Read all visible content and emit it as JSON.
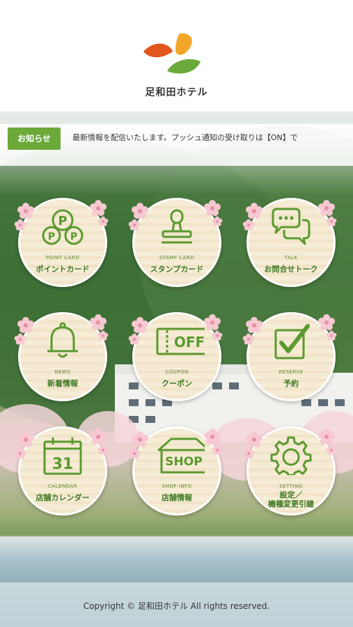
{
  "header": {
    "brand_name": "足和田ホテル",
    "logo_colors": [
      "#e3561c",
      "#f2a628",
      "#6aa93a"
    ]
  },
  "notice": {
    "tag_label": "お知らせ",
    "message": "最新情報を配信いたします。プッシュ通知の受け取りは【ON】で"
  },
  "menu": {
    "items": [
      {
        "en": "POINT CARD",
        "jp": "ポイントカード",
        "icon": "point-card-icon"
      },
      {
        "en": "STAMP CARD",
        "jp": "スタンプカード",
        "icon": "stamp-icon"
      },
      {
        "en": "TALK",
        "jp": "お問合せトーク",
        "icon": "chat-bubbles-icon"
      },
      {
        "en": "NEWS",
        "jp": "新着情報",
        "icon": "bell-icon"
      },
      {
        "en": "COUPON",
        "jp": "クーポン",
        "icon": "coupon-icon",
        "icon_text": "OFF"
      },
      {
        "en": "RESERVE",
        "jp": "予約",
        "icon": "checkbox-icon"
      },
      {
        "en": "CALENDAR",
        "jp": "店舗カレンダー",
        "icon": "calendar-icon",
        "icon_text": "31"
      },
      {
        "en": "SHOP INFO",
        "jp": "店舗情報",
        "icon": "shop-icon",
        "icon_text": "SHOP"
      },
      {
        "en": "SETTING",
        "jp_line1": "設定／",
        "jp_line2": "機種変更引継",
        "icon": "gear-icon"
      }
    ]
  },
  "footer": {
    "copyright": "Copyright © 足和田ホテル All rights reserved."
  },
  "colors": {
    "accent_green": "#6aa93a",
    "icon_green": "#5a9a2e",
    "label_green": "#3d7a22"
  }
}
